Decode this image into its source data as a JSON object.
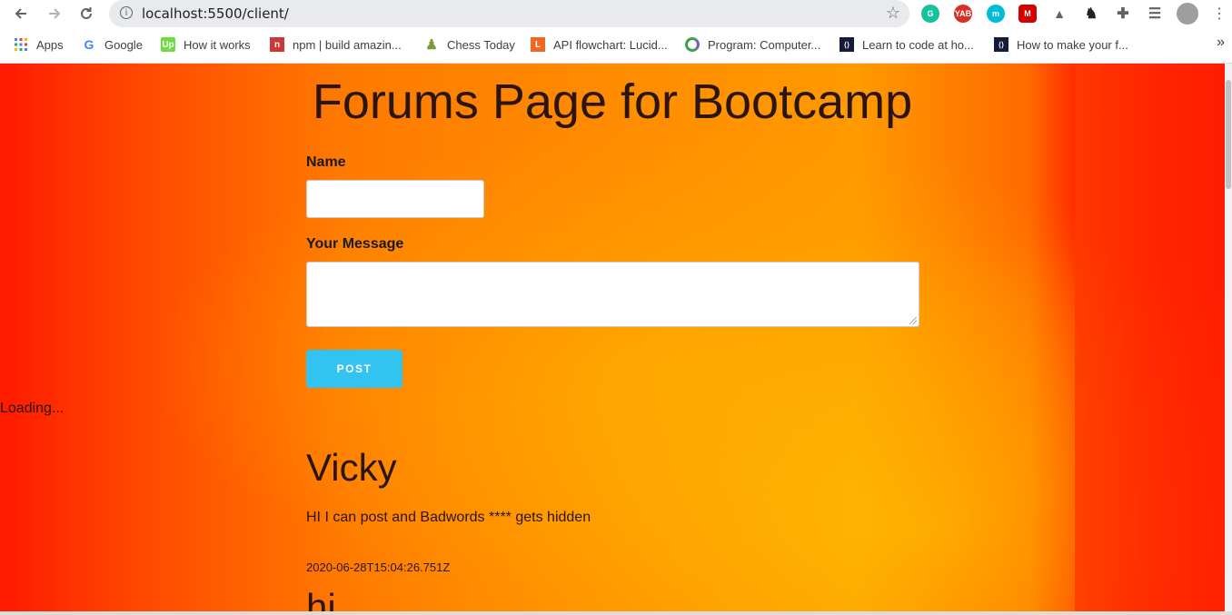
{
  "browser": {
    "url": "localhost:5500/client/",
    "bookmarks": [
      {
        "label": "Apps",
        "icon": "apps-grid-icon",
        "color": "#4285f4"
      },
      {
        "label": "Google",
        "icon": "google-icon",
        "color": "#4285f4"
      },
      {
        "label": "How it works",
        "icon": "upwork-icon",
        "color": "#6fda44"
      },
      {
        "label": "npm | build amazin...",
        "icon": "npm-icon",
        "color": "#cb3837"
      },
      {
        "label": "Chess Today",
        "icon": "chess-pawn-icon",
        "color": "#7b9a3b"
      },
      {
        "label": "API flowchart: Lucid...",
        "icon": "lucid-icon",
        "color": "#f26522"
      },
      {
        "label": "Program: Computer...",
        "icon": "program-ring-icon",
        "color": "#3aa34b"
      },
      {
        "label": "Learn to code at ho...",
        "icon": "codecademy-icon",
        "color": "#141c3a"
      },
      {
        "label": "How to make your f...",
        "icon": "codecademy-icon",
        "color": "#141c3a"
      }
    ]
  },
  "page": {
    "title": "Forums Page for Bootcamp",
    "form": {
      "name_label": "Name",
      "message_label": "Your Message",
      "post_button": "POST"
    },
    "loading_text": "Loading...",
    "posts": [
      {
        "name": "Vicky",
        "message": "HI I can post and Badwords **** gets hidden",
        "date": "2020-06-28T15:04:26.751Z"
      },
      {
        "name": "hi"
      }
    ]
  }
}
